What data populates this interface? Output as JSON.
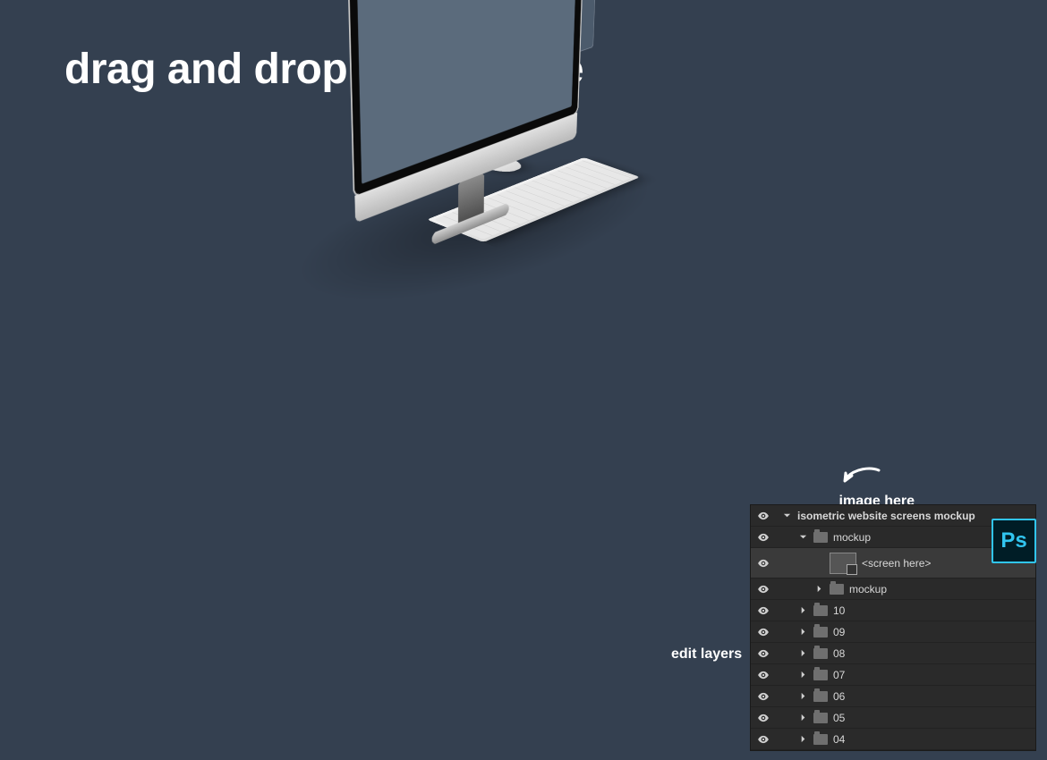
{
  "headline": "drag and drop your image",
  "annotations": {
    "image_here": "image here",
    "edit_layers": "edit layers"
  },
  "ps_badge": "Ps",
  "layers": [
    {
      "indent": 0,
      "expand": "down",
      "icon": "none",
      "label": "isometric website screens mockup",
      "header": true,
      "selected": false,
      "smart": false
    },
    {
      "indent": 1,
      "expand": "down",
      "icon": "folder",
      "label": "mockup",
      "header": false,
      "selected": false,
      "smart": false
    },
    {
      "indent": 2,
      "expand": "none",
      "icon": "smart",
      "label": "<screen here>",
      "header": false,
      "selected": true,
      "smart": true
    },
    {
      "indent": 2,
      "expand": "right",
      "icon": "folder",
      "label": "mockup",
      "header": false,
      "selected": false,
      "smart": false
    },
    {
      "indent": 1,
      "expand": "right",
      "icon": "folder",
      "label": "10",
      "header": false,
      "selected": false,
      "smart": false
    },
    {
      "indent": 1,
      "expand": "right",
      "icon": "folder",
      "label": "09",
      "header": false,
      "selected": false,
      "smart": false
    },
    {
      "indent": 1,
      "expand": "right",
      "icon": "folder",
      "label": "08",
      "header": false,
      "selected": false,
      "smart": false
    },
    {
      "indent": 1,
      "expand": "right",
      "icon": "folder",
      "label": "07",
      "header": false,
      "selected": false,
      "smart": false
    },
    {
      "indent": 1,
      "expand": "right",
      "icon": "folder",
      "label": "06",
      "header": false,
      "selected": false,
      "smart": false
    },
    {
      "indent": 1,
      "expand": "right",
      "icon": "folder",
      "label": "05",
      "header": false,
      "selected": false,
      "smart": false
    },
    {
      "indent": 1,
      "expand": "right",
      "icon": "folder",
      "label": "04",
      "header": false,
      "selected": false,
      "smart": false
    }
  ]
}
